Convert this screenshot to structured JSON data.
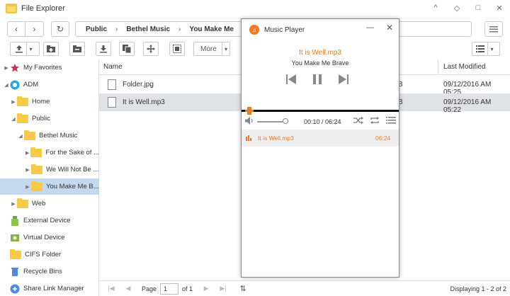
{
  "window": {
    "title": "File Explorer",
    "minimize": "^",
    "restore": "◇",
    "maximize": "□",
    "close": "✕"
  },
  "nav": {
    "back": "‹",
    "forward": "›",
    "refresh": "↻",
    "breadcrumb": [
      "Public",
      "Bethel Music",
      "You Make Me"
    ],
    "separator": "›"
  },
  "toolbar": {
    "more_label": "More"
  },
  "sidebar": {
    "items": [
      {
        "label": "My Favorites"
      },
      {
        "label": "ADM"
      },
      {
        "label": "Home"
      },
      {
        "label": "Public"
      },
      {
        "label": "Bethel Music"
      },
      {
        "label": "For the Sake of ..."
      },
      {
        "label": "We Will Not Be ..."
      },
      {
        "label": "You Make Me B..."
      },
      {
        "label": "Web"
      },
      {
        "label": "External Device"
      },
      {
        "label": "Virtual Device"
      },
      {
        "label": "CIFS Folder"
      },
      {
        "label": "Recycle Bins"
      },
      {
        "label": "Share Link Manager"
      }
    ]
  },
  "filelist": {
    "columns": {
      "name": "Name",
      "modified": "Last Modified"
    },
    "rows": [
      {
        "name": "Folder.jpg",
        "size_suffix": "B",
        "modified": "09/12/2016 AM 05:25"
      },
      {
        "name": "It is Well.mp3",
        "size_suffix": "B",
        "modified": "09/12/2016 AM 05:22"
      }
    ]
  },
  "statusbar": {
    "page_label": "Page",
    "page_value": "1",
    "of_label": "of 1",
    "displaying": "Displaying 1 - 2 of 2"
  },
  "player": {
    "title": "Music Player",
    "minimize": "—",
    "close": "✕",
    "now_playing": "It is Well.mp3",
    "album": "You Make Me Brave",
    "time": "00:10 / 06:24",
    "progress_fraction": 0.026,
    "volume_fraction": 0.9,
    "playlist": [
      {
        "name": "It is Well.mp3",
        "duration": "06:24"
      }
    ]
  },
  "colors": {
    "accent": "#f07820",
    "selection": "#c4d8ef"
  }
}
